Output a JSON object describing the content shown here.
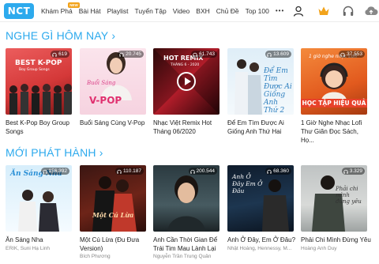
{
  "header": {
    "logo": "NCT",
    "nav": [
      {
        "label": "Khám Phá",
        "badge": "NEW"
      },
      {
        "label": "Bài Hát"
      },
      {
        "label": "Playlist"
      },
      {
        "label": "Tuyển Tập"
      },
      {
        "label": "Video"
      },
      {
        "label": "BXH"
      },
      {
        "label": "Chủ Đề"
      },
      {
        "label": "Top 100"
      }
    ],
    "more": "•••",
    "icons": [
      "user-icon",
      "crown-icon",
      "headphones-icon",
      "upload-icon"
    ],
    "accent": "#2daaed",
    "crown_color": "#f2a31b"
  },
  "section1": {
    "title": "NGHE GÌ HÔM NAY",
    "chevron": "›",
    "cards": [
      {
        "title": "Best K-Pop Boy Group Songs",
        "views": "619",
        "art": {
          "top": "BEST K-POP",
          "sub": "Boy Group Songs"
        }
      },
      {
        "title": "Buổi Sáng Cùng V-Pop",
        "views": "20.745",
        "art": {
          "script": "Buổi Sáng",
          "big": "V-POP"
        }
      },
      {
        "title": "Nhạc Việt Remix Hot Tháng 06/2020",
        "views": "61.743",
        "art": {
          "top": "HOT REMIX",
          "sub": "THÁNG 6 - 2020"
        }
      },
      {
        "title": "Để Em Tìm Được Ai Giống Anh Thứ Hai",
        "views": "13.609",
        "art": {
          "script": "Để Em Tìm Được Ai Giống Anh Thứ 2"
        }
      },
      {
        "title": "1 Giờ Nghe Nhạc Lofi Thư Giãn Đọc Sách, Họ...",
        "views": "37.553",
        "art": {
          "script": "1 giờ nghe nhạc Lofi",
          "banner": "HỌC TẬP HIỆU QUẢ"
        }
      }
    ]
  },
  "section2": {
    "title": "MỚI PHÁT HÀNH",
    "chevron": "›",
    "cards": [
      {
        "title": "Ăn Sáng Nha",
        "artist": "ERIK, Suni Hạ Linh",
        "views": "156.392",
        "art": {
          "script": "Ăn Sáng Nha"
        }
      },
      {
        "title": "Một Cú Lừa (Đu Đưa Version)",
        "artist": "Bích Phương",
        "views": "110.187",
        "art": {
          "script": "Một Cú Lừa"
        }
      },
      {
        "title": "Anh Cần Thời Gian Để Trái Tim Mau Lành Lại",
        "artist": "Nguyễn Trần Trung Quân",
        "views": "200.544",
        "art": {}
      },
      {
        "title": "Anh Ở Đây, Em Ở Đâu?",
        "artist": "Nhật Hoàng, Hennessy, M...",
        "views": "68.360",
        "art": {
          "script": "Anh Ở Đây Em Ở Đâu"
        }
      },
      {
        "title": "Phải Chi Mình Đừng Yêu",
        "artist": "Hoàng Anh Duy",
        "views": "3.329",
        "art": {
          "script": "Phải chi mình đừng yêu"
        }
      }
    ]
  }
}
